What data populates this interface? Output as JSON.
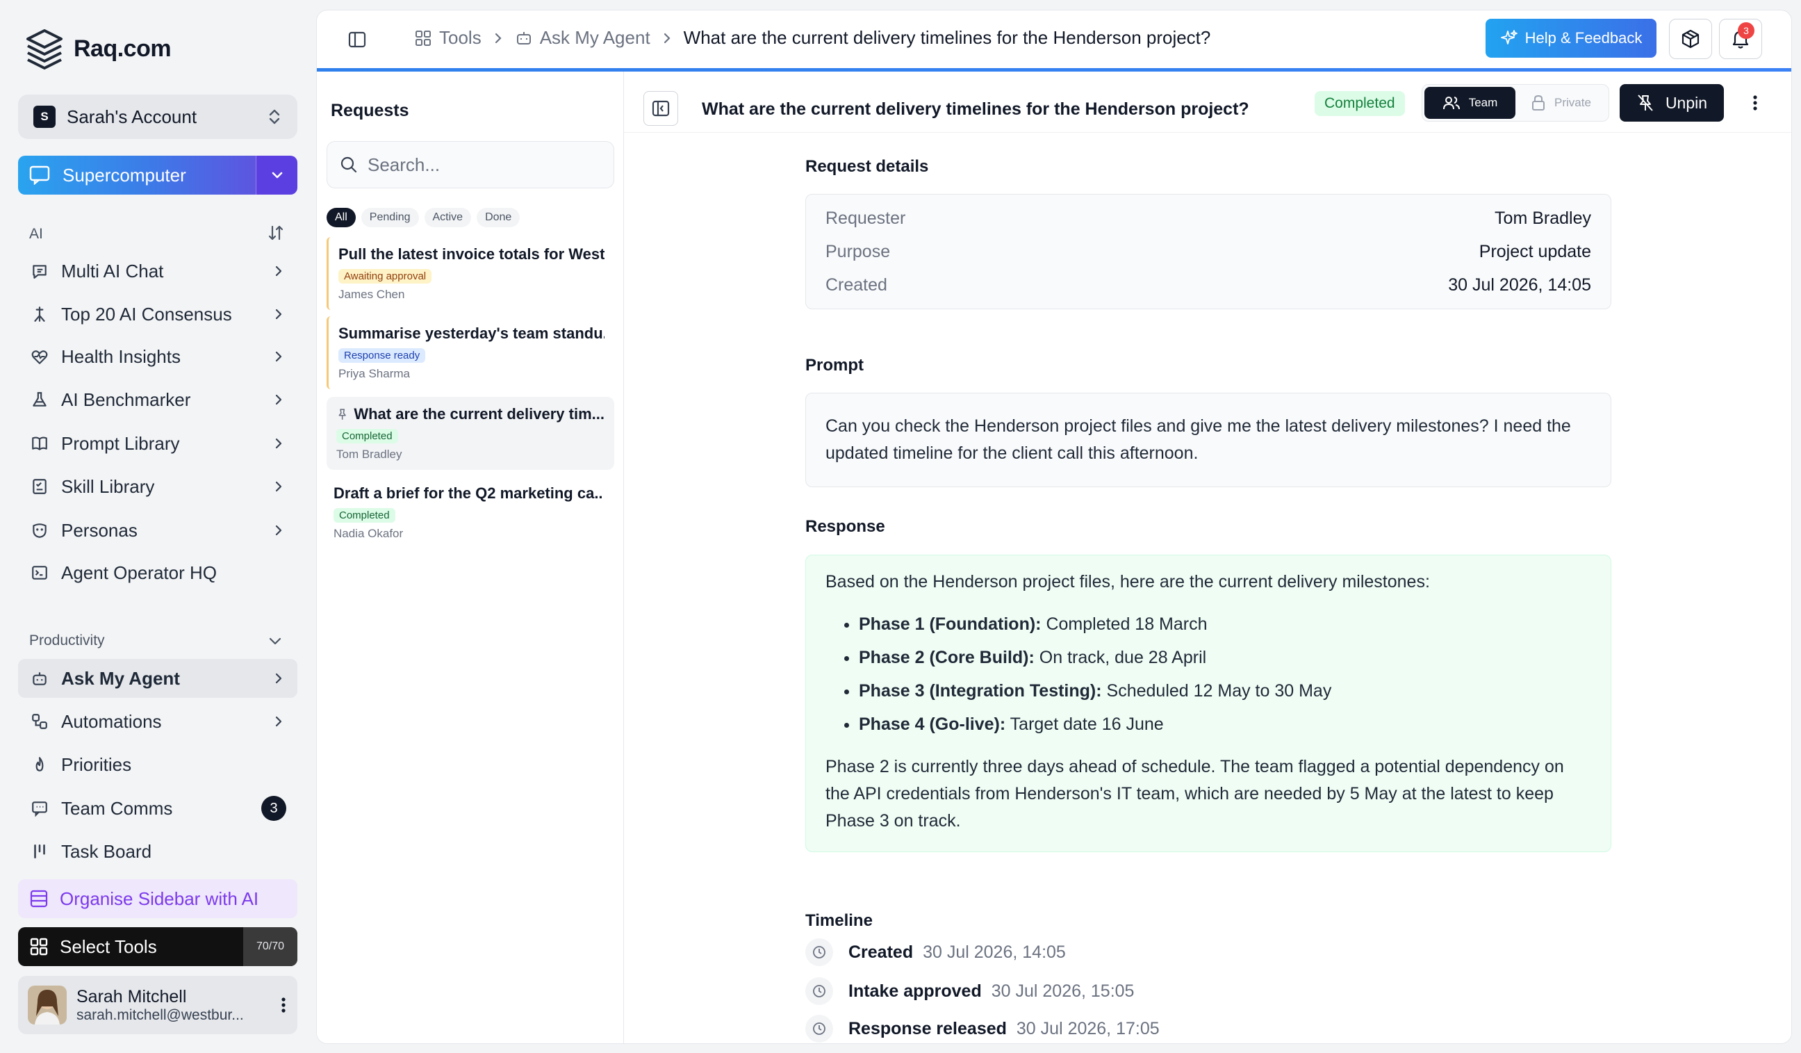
{
  "brand": {
    "name": "Raq.com"
  },
  "account": {
    "initial": "S",
    "name": "Sarah's Account"
  },
  "supercomputer": {
    "label": "Supercomputer"
  },
  "sections": {
    "ai": "AI",
    "productivity": "Productivity"
  },
  "ai_items": [
    {
      "label": "Multi AI Chat",
      "icon": "chat-icon"
    },
    {
      "label": "Top 20 AI Consensus",
      "icon": "consensus-icon"
    },
    {
      "label": "Health Insights",
      "icon": "heart-pulse-icon"
    },
    {
      "label": "AI Benchmarker",
      "icon": "flask-icon"
    },
    {
      "label": "Prompt Library",
      "icon": "book-icon"
    },
    {
      "label": "Skill Library",
      "icon": "checklist-icon"
    },
    {
      "label": "Personas",
      "icon": "mask-icon"
    },
    {
      "label": "Agent Operator HQ",
      "icon": "terminal-icon"
    }
  ],
  "prod_items": [
    {
      "label": "Ask My Agent",
      "icon": "bot-icon"
    },
    {
      "label": "Automations",
      "icon": "workflow-icon"
    },
    {
      "label": "Priorities",
      "icon": "flame-icon"
    },
    {
      "label": "Team Comms",
      "icon": "message-icon",
      "badge": "3"
    },
    {
      "label": "Task Board",
      "icon": "kanban-icon"
    }
  ],
  "organise": {
    "label": "Organise Sidebar with AI"
  },
  "select_tools": {
    "label": "Select Tools",
    "count": "70/70"
  },
  "user": {
    "name": "Sarah Mitchell",
    "email": "sarah.mitchell@westbur..."
  },
  "topbar": {
    "crumbs": [
      "Tools",
      "Ask My Agent",
      "What are the current delivery timelines for the Henderson project?"
    ],
    "help_label": "Help & Feedback",
    "notif_count": "3"
  },
  "requests": {
    "title": "Requests",
    "search_placeholder": "Search...",
    "filters": [
      "All",
      "Pending",
      "Active",
      "Done"
    ],
    "items": [
      {
        "title": "Pull the latest invoice totals for West...",
        "tag": "Awaiting approval",
        "by": "James Chen"
      },
      {
        "title": "Summarise yesterday's team standu...",
        "tag": "Response ready",
        "by": "Priya Sharma"
      },
      {
        "title": "What are the current delivery tim...",
        "tag": "Completed",
        "by": "Tom Bradley"
      },
      {
        "title": "Draft a brief for the Q2 marketing ca...",
        "tag": "Completed",
        "by": "Nadia Okafor"
      }
    ]
  },
  "detail": {
    "title": "What are the current delivery timelines for the Henderson project?",
    "status": "Completed",
    "visibility": {
      "team": "Team",
      "private": "Private"
    },
    "unpin": "Unpin",
    "request_details_label": "Request details",
    "details": [
      {
        "k": "Requester",
        "v": "Tom Bradley"
      },
      {
        "k": "Purpose",
        "v": "Project update"
      },
      {
        "k": "Created",
        "v": "30 Jul 2026, 14:05"
      }
    ],
    "prompt_label": "Prompt",
    "prompt": "Can you check the Henderson project files and give me the latest delivery milestones? I need the updated timeline for the client call this afternoon.",
    "response_label": "Response",
    "response_intro": "Based on the Henderson project files, here are the current delivery milestones:",
    "milestones": [
      {
        "phase": "Phase 1 (Foundation):",
        "text": "Completed 18 March"
      },
      {
        "phase": "Phase 2 (Core Build):",
        "text": "On track, due 28 April"
      },
      {
        "phase": "Phase 3 (Integration Testing):",
        "text": "Scheduled 12 May to 30 May"
      },
      {
        "phase": "Phase 4 (Go-live):",
        "text": "Target date 16 June"
      }
    ],
    "response_outro": "Phase 2 is currently three days ahead of schedule. The team flagged a potential dependency on the API credentials from Henderson's IT team, which are needed by 5 May at the latest to keep Phase 3 on track.",
    "timeline_label": "Timeline",
    "timeline": [
      {
        "event": "Created",
        "ts": "30 Jul 2026, 14:05"
      },
      {
        "event": "Intake approved",
        "ts": "30 Jul 2026, 15:05"
      },
      {
        "event": "Response released",
        "ts": "30 Jul 2026, 17:05"
      }
    ]
  },
  "colors": {
    "accent": "#3b82f6",
    "brand_gradient_start": "#22a3f0",
    "brand_gradient_end": "#5d55e0",
    "success": "#15803d"
  }
}
